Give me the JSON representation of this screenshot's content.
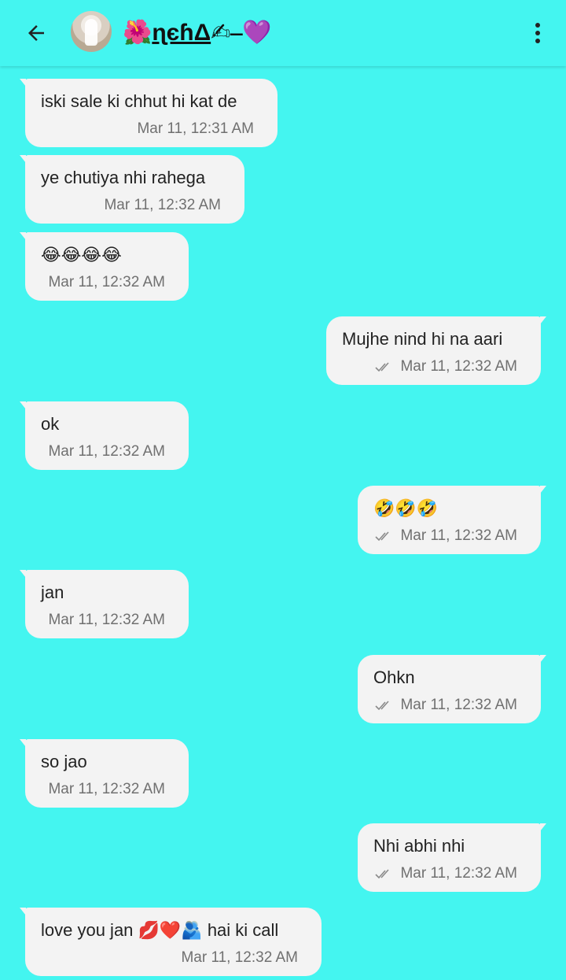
{
  "header": {
    "title_prefix": "🌺",
    "title_name": "ɳєɦΔ",
    "title_suffix": "✍⎯💜"
  },
  "messages": [
    {
      "dir": "in",
      "text": "iski sale ki chhut hi kat de",
      "time": "Mar 11, 12:31 AM"
    },
    {
      "dir": "in",
      "text": "ye chutiya nhi rahega",
      "time": "Mar 11, 12:32 AM"
    },
    {
      "dir": "in",
      "text": "😂😂😂😂",
      "time": "Mar 11, 12:32 AM"
    },
    {
      "dir": "out",
      "text": "Mujhe nind hi na aari",
      "time": "Mar 11, 12:32 AM",
      "status": "read"
    },
    {
      "dir": "in",
      "text": "ok",
      "time": "Mar 11, 12:32 AM"
    },
    {
      "dir": "out",
      "text": "🤣🤣🤣",
      "time": "Mar 11, 12:32 AM",
      "status": "read"
    },
    {
      "dir": "in",
      "text": "jan",
      "time": "Mar 11, 12:32 AM"
    },
    {
      "dir": "out",
      "text": "Ohkn",
      "time": "Mar 11, 12:32 AM",
      "status": "read"
    },
    {
      "dir": "in",
      "text": "so jao",
      "time": "Mar 11, 12:32 AM"
    },
    {
      "dir": "out",
      "text": "Nhi abhi nhi",
      "time": "Mar 11, 12:32 AM",
      "status": "read"
    },
    {
      "dir": "in",
      "text": "love you jan 💋❤️🫂 hai ki call",
      "time": "Mar 11, 12:32 AM"
    }
  ],
  "colors": {
    "background": "#44f5f0",
    "bubble": "#f3f3f3",
    "text": "#222222",
    "meta": "#707070"
  },
  "icons": {
    "back": "arrow-left-icon",
    "menu": "more-vertical-icon",
    "status": "double-check-icon"
  }
}
